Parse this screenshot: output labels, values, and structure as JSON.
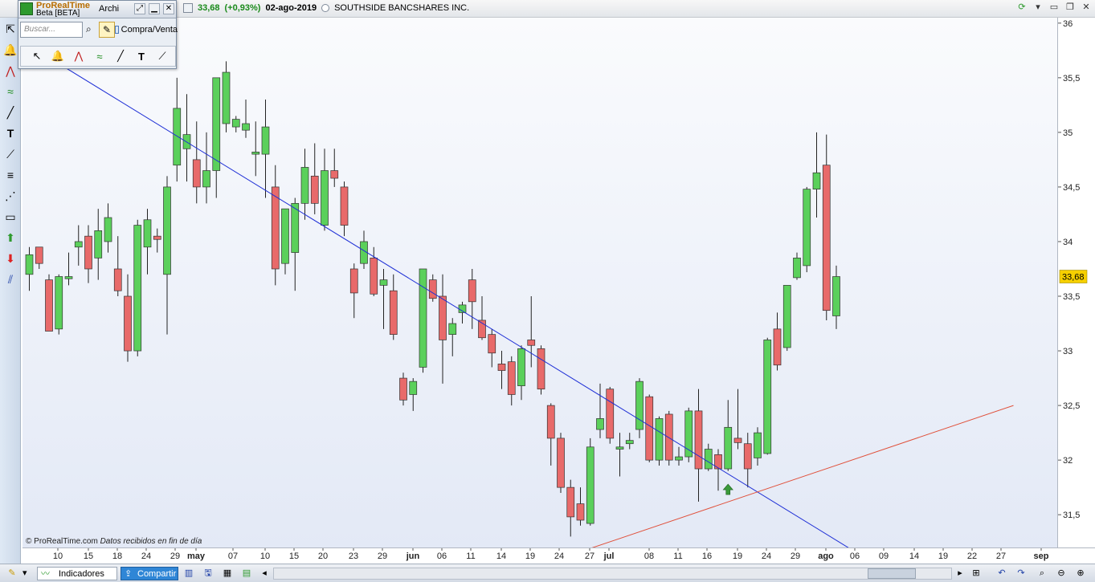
{
  "app": {
    "name": "ProRealTime",
    "subtitle": "Beta [BETA]",
    "menu_file": "Archi"
  },
  "quote": {
    "price": "33,68",
    "change": "(+0,93%)",
    "date": "02-ago-2019",
    "instrument": "SOUTHSIDE BANCSHARES INC."
  },
  "toolbar": {
    "search_placeholder": "Buscar...",
    "compra_label": "Compra/Venta"
  },
  "footer": {
    "copyright": "© ProRealTime.com",
    "data_note": "Datos recibidos en fin de día",
    "indicators_label": "Indicadores",
    "share_label": "Compartir"
  },
  "price_axis": {
    "labels": [
      "36",
      "35,5",
      "35",
      "34,5",
      "34",
      "33,5",
      "33",
      "32,5",
      "32",
      "31,5"
    ],
    "current_price_label": "33,68",
    "current_price_color": "#f6d000"
  },
  "date_axis": {
    "labels": [
      "10",
      "15",
      "18",
      "24",
      "29",
      "may",
      "07",
      "10",
      "15",
      "20",
      "23",
      "29",
      "jun",
      "06",
      "11",
      "14",
      "19",
      "24",
      "27",
      "jul",
      "08",
      "11",
      "16",
      "19",
      "24",
      "29",
      "ago",
      "06",
      "09",
      "14",
      "19",
      "22",
      "27",
      "sep"
    ]
  },
  "colors": {
    "up_candle": "#5bd05b",
    "down_candle": "#e86a6a",
    "trendline_down": "#1e2fd6",
    "trendline_up": "#e0503a",
    "signal_arrow": "#3a9a3a"
  },
  "chart_data": {
    "type": "candlestick",
    "title": "",
    "ylim": [
      31.2,
      36.05
    ],
    "candles": [
      {
        "o": 33.7,
        "h": 33.95,
        "l": 33.55,
        "c": 33.88
      },
      {
        "o": 33.95,
        "h": 33.95,
        "l": 33.75,
        "c": 33.8
      },
      {
        "o": 33.65,
        "h": 33.7,
        "l": 33.2,
        "c": 33.18
      },
      {
        "o": 33.2,
        "h": 33.7,
        "l": 33.15,
        "c": 33.68
      },
      {
        "o": 33.66,
        "h": 33.9,
        "l": 33.6,
        "c": 33.68
      },
      {
        "o": 33.95,
        "h": 34.15,
        "l": 33.78,
        "c": 34.0
      },
      {
        "o": 34.05,
        "h": 34.15,
        "l": 33.62,
        "c": 33.75
      },
      {
        "o": 33.85,
        "h": 34.3,
        "l": 33.65,
        "c": 34.1
      },
      {
        "o": 34.0,
        "h": 34.35,
        "l": 33.9,
        "c": 34.22
      },
      {
        "o": 33.75,
        "h": 34.05,
        "l": 33.5,
        "c": 33.55
      },
      {
        "o": 33.5,
        "h": 33.7,
        "l": 32.9,
        "c": 33.0
      },
      {
        "o": 33.0,
        "h": 34.2,
        "l": 32.95,
        "c": 34.15
      },
      {
        "o": 33.95,
        "h": 34.3,
        "l": 33.7,
        "c": 34.2
      },
      {
        "o": 34.05,
        "h": 34.12,
        "l": 33.9,
        "c": 34.02
      },
      {
        "o": 33.7,
        "h": 34.6,
        "l": 33.15,
        "c": 34.5
      },
      {
        "o": 34.7,
        "h": 35.5,
        "l": 34.55,
        "c": 35.22
      },
      {
        "o": 34.85,
        "h": 35.35,
        "l": 34.55,
        "c": 34.98
      },
      {
        "o": 34.75,
        "h": 35.1,
        "l": 34.35,
        "c": 34.5
      },
      {
        "o": 34.5,
        "h": 35.0,
        "l": 34.35,
        "c": 34.65
      },
      {
        "o": 34.65,
        "h": 35.05,
        "l": 34.4,
        "c": 35.5
      },
      {
        "o": 35.08,
        "h": 35.65,
        "l": 35.0,
        "c": 35.55
      },
      {
        "o": 35.05,
        "h": 35.15,
        "l": 35.0,
        "c": 35.12
      },
      {
        "o": 35.02,
        "h": 35.3,
        "l": 34.95,
        "c": 35.08
      },
      {
        "o": 34.8,
        "h": 35.1,
        "l": 34.6,
        "c": 34.82
      },
      {
        "o": 34.8,
        "h": 35.3,
        "l": 34.4,
        "c": 35.05
      },
      {
        "o": 34.5,
        "h": 34.7,
        "l": 33.6,
        "c": 33.75
      },
      {
        "o": 33.8,
        "h": 34.3,
        "l": 33.7,
        "c": 34.3
      },
      {
        "o": 33.9,
        "h": 34.4,
        "l": 33.55,
        "c": 34.35
      },
      {
        "o": 34.35,
        "h": 34.85,
        "l": 34.2,
        "c": 34.68
      },
      {
        "o": 34.6,
        "h": 34.9,
        "l": 34.25,
        "c": 34.35
      },
      {
        "o": 34.15,
        "h": 34.85,
        "l": 34.1,
        "c": 34.65
      },
      {
        "o": 34.65,
        "h": 34.85,
        "l": 34.5,
        "c": 34.58
      },
      {
        "o": 34.5,
        "h": 34.55,
        "l": 34.05,
        "c": 34.15
      },
      {
        "o": 33.75,
        "h": 33.8,
        "l": 33.3,
        "c": 33.53
      },
      {
        "o": 33.8,
        "h": 34.1,
        "l": 33.75,
        "c": 34.0
      },
      {
        "o": 33.85,
        "h": 33.95,
        "l": 33.5,
        "c": 33.52
      },
      {
        "o": 33.6,
        "h": 33.75,
        "l": 33.2,
        "c": 33.65
      },
      {
        "o": 33.55,
        "h": 33.7,
        "l": 33.1,
        "c": 33.15
      },
      {
        "o": 32.75,
        "h": 32.8,
        "l": 32.5,
        "c": 32.55
      },
      {
        "o": 32.6,
        "h": 32.75,
        "l": 32.45,
        "c": 32.72
      },
      {
        "o": 32.85,
        "h": 33.75,
        "l": 32.8,
        "c": 33.75
      },
      {
        "o": 33.65,
        "h": 33.7,
        "l": 33.45,
        "c": 33.48
      },
      {
        "o": 33.5,
        "h": 33.7,
        "l": 32.7,
        "c": 33.1
      },
      {
        "o": 33.15,
        "h": 33.3,
        "l": 32.95,
        "c": 33.25
      },
      {
        "o": 33.35,
        "h": 33.45,
        "l": 33.25,
        "c": 33.42
      },
      {
        "o": 33.65,
        "h": 33.75,
        "l": 33.2,
        "c": 33.45
      },
      {
        "o": 33.28,
        "h": 33.5,
        "l": 33.1,
        "c": 33.12
      },
      {
        "o": 33.15,
        "h": 33.2,
        "l": 32.85,
        "c": 32.98
      },
      {
        "o": 32.88,
        "h": 33.0,
        "l": 32.65,
        "c": 32.82
      },
      {
        "o": 32.9,
        "h": 32.95,
        "l": 32.5,
        "c": 32.6
      },
      {
        "o": 32.68,
        "h": 33.05,
        "l": 32.55,
        "c": 33.02
      },
      {
        "o": 33.1,
        "h": 33.5,
        "l": 32.85,
        "c": 33.05
      },
      {
        "o": 33.02,
        "h": 33.05,
        "l": 32.6,
        "c": 32.65
      },
      {
        "o": 32.5,
        "h": 32.52,
        "l": 31.95,
        "c": 32.2
      },
      {
        "o": 32.2,
        "h": 32.25,
        "l": 31.7,
        "c": 31.75
      },
      {
        "o": 31.75,
        "h": 31.82,
        "l": 31.3,
        "c": 31.48
      },
      {
        "o": 31.6,
        "h": 31.75,
        "l": 31.4,
        "c": 31.45
      },
      {
        "o": 31.42,
        "h": 32.2,
        "l": 31.4,
        "c": 32.12
      },
      {
        "o": 32.28,
        "h": 32.7,
        "l": 32.2,
        "c": 32.38
      },
      {
        "o": 32.65,
        "h": 32.67,
        "l": 32.15,
        "c": 32.2
      },
      {
        "o": 32.1,
        "h": 32.25,
        "l": 31.85,
        "c": 32.12
      },
      {
        "o": 32.15,
        "h": 32.25,
        "l": 32.1,
        "c": 32.18
      },
      {
        "o": 32.28,
        "h": 32.75,
        "l": 32.2,
        "c": 32.72
      },
      {
        "o": 32.58,
        "h": 32.6,
        "l": 31.98,
        "c": 32.0
      },
      {
        "o": 32.0,
        "h": 32.4,
        "l": 31.95,
        "c": 32.38
      },
      {
        "o": 32.42,
        "h": 32.45,
        "l": 31.95,
        "c": 32.0
      },
      {
        "o": 32.0,
        "h": 32.12,
        "l": 31.95,
        "c": 32.03
      },
      {
        "o": 32.03,
        "h": 32.48,
        "l": 31.98,
        "c": 32.45
      },
      {
        "o": 32.45,
        "h": 32.65,
        "l": 31.62,
        "c": 31.92
      },
      {
        "o": 31.92,
        "h": 32.15,
        "l": 31.9,
        "c": 32.1
      },
      {
        "o": 32.05,
        "h": 32.1,
        "l": 31.72,
        "c": 31.92
      },
      {
        "o": 31.92,
        "h": 32.55,
        "l": 31.9,
        "c": 32.3
      },
      {
        "o": 32.2,
        "h": 32.65,
        "l": 32.1,
        "c": 32.16
      },
      {
        "o": 32.15,
        "h": 32.25,
        "l": 31.75,
        "c": 31.92
      },
      {
        "o": 32.02,
        "h": 32.3,
        "l": 31.95,
        "c": 32.25
      },
      {
        "o": 32.06,
        "h": 33.12,
        "l": 32.05,
        "c": 33.1
      },
      {
        "o": 33.2,
        "h": 33.35,
        "l": 32.82,
        "c": 32.87
      },
      {
        "o": 33.03,
        "h": 33.6,
        "l": 33.0,
        "c": 33.6
      },
      {
        "o": 33.67,
        "h": 33.9,
        "l": 33.65,
        "c": 33.85
      },
      {
        "o": 33.78,
        "h": 34.5,
        "l": 33.72,
        "c": 34.48
      },
      {
        "o": 34.48,
        "h": 35.0,
        "l": 34.22,
        "c": 34.63
      },
      {
        "o": 34.7,
        "h": 34.98,
        "l": 33.28,
        "c": 33.37
      },
      {
        "o": 33.32,
        "h": 33.78,
        "l": 33.2,
        "c": 33.68
      }
    ],
    "trendlines": [
      {
        "name": "resistance",
        "from": {
          "i": -1,
          "y": 35.85
        },
        "to": {
          "i": 85,
          "y": 31.1
        }
      },
      {
        "name": "support",
        "from": {
          "i": 54,
          "y": 31.1
        },
        "to": {
          "i": 100,
          "y": 32.5
        }
      }
    ],
    "signal_arrow": {
      "i": 71,
      "y": 31.78
    },
    "current_price": 33.68
  }
}
